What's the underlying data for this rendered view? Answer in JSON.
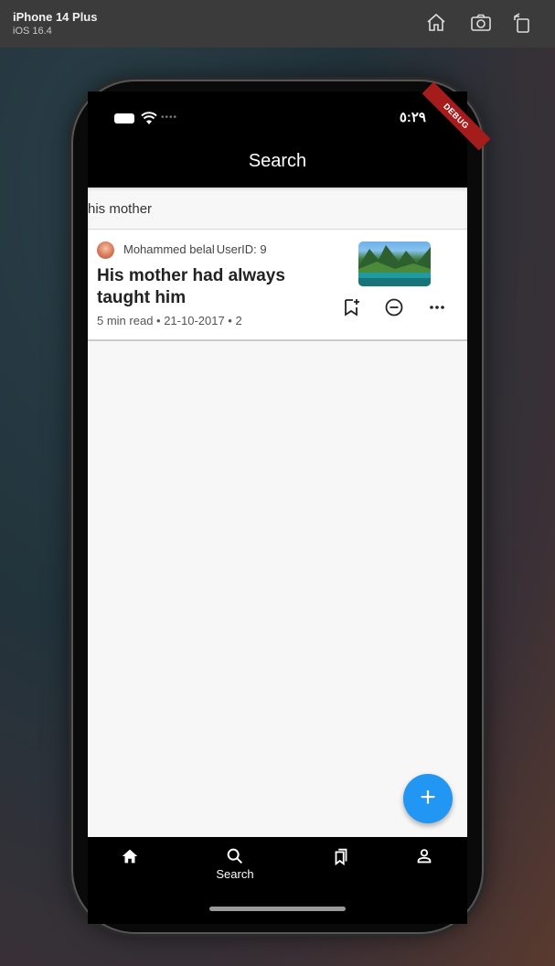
{
  "simulator": {
    "device_name": "iPhone 14 Plus",
    "os_version": "iOS 16.4",
    "buttons": [
      "home-icon",
      "screenshot-icon",
      "rotate-icon"
    ]
  },
  "status_bar": {
    "time": "٥:٢٩",
    "signal_dots": "••••",
    "debug_banner": "DEBUG"
  },
  "app_bar": {
    "title": "Search"
  },
  "search": {
    "value": "his mother"
  },
  "results": [
    {
      "author": "Mohammed belal",
      "user_id": "UserID: 9",
      "title": "His mother had always taught him",
      "read_time": "5 min read",
      "date": "21-10-2017",
      "count": "2",
      "meta": "5 min read • 21-10-2017 • 2",
      "actions": [
        "bookmark-add-icon",
        "remove-circle-icon",
        "more-horizontal-icon"
      ]
    }
  ],
  "fab": {
    "label": "+"
  },
  "bottom_nav": {
    "items": [
      {
        "icon": "home-icon",
        "label": ""
      },
      {
        "icon": "search-icon",
        "label": "Search"
      },
      {
        "icon": "bookmarks-icon",
        "label": ""
      },
      {
        "icon": "person-icon",
        "label": ""
      }
    ],
    "selected": "Search"
  },
  "colors": {
    "accent": "#2196f3",
    "debug": "#a51c1c",
    "app_bar": "#000000",
    "background": "#f7f7f7"
  }
}
